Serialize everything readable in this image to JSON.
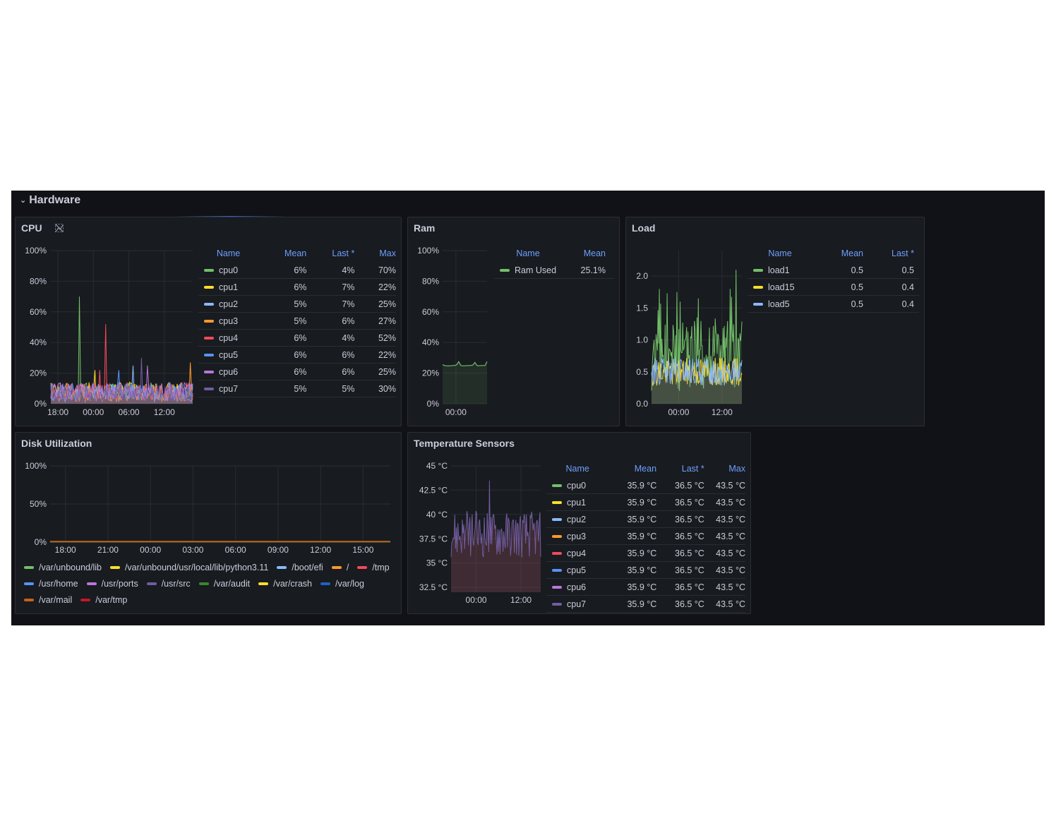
{
  "row": {
    "title": "Hardware"
  },
  "colors": {
    "background": "#111217",
    "panel": "#181b1f",
    "border": "#2c2e33",
    "text": "#ccccdc",
    "header_blue": "#6e9fff",
    "green": "#73bf69",
    "yellow": "#fade2a",
    "light_blue": "#8ab8ff",
    "orange": "#ff9830",
    "red": "#f2495c",
    "blue": "#5794f2",
    "purple": "#b877d9",
    "dark_purple": "#705da0",
    "dark_green": "#37872d",
    "dark_blue": "#1f60c4",
    "dark_orange": "#c4621a",
    "dark_red": "#c4162a"
  },
  "panels": {
    "cpu": {
      "title": "CPU",
      "icon": "no-data-link-icon",
      "columns": [
        "Name",
        "Mean",
        "Last *",
        "Max"
      ],
      "rows": [
        {
          "name": "cpu0",
          "color": "#73bf69",
          "mean": "6%",
          "last": "4%",
          "max": "70%"
        },
        {
          "name": "cpu1",
          "color": "#fade2a",
          "mean": "6%",
          "last": "7%",
          "max": "22%"
        },
        {
          "name": "cpu2",
          "color": "#8ab8ff",
          "mean": "5%",
          "last": "7%",
          "max": "25%"
        },
        {
          "name": "cpu3",
          "color": "#ff9830",
          "mean": "5%",
          "last": "6%",
          "max": "27%"
        },
        {
          "name": "cpu4",
          "color": "#f2495c",
          "mean": "6%",
          "last": "4%",
          "max": "52%"
        },
        {
          "name": "cpu5",
          "color": "#5794f2",
          "mean": "6%",
          "last": "6%",
          "max": "22%"
        },
        {
          "name": "cpu6",
          "color": "#b877d9",
          "mean": "6%",
          "last": "6%",
          "max": "25%"
        },
        {
          "name": "cpu7",
          "color": "#705da0",
          "mean": "5%",
          "last": "5%",
          "max": "30%"
        }
      ]
    },
    "ram": {
      "title": "Ram",
      "columns": [
        "Name",
        "Mean"
      ],
      "rows": [
        {
          "name": "Ram Used",
          "color": "#73bf69",
          "mean": "25.1%"
        }
      ]
    },
    "load": {
      "title": "Load",
      "columns": [
        "Name",
        "Mean",
        "Last *"
      ],
      "rows": [
        {
          "name": "load1",
          "color": "#73bf69",
          "mean": "0.5",
          "last": "0.5"
        },
        {
          "name": "load15",
          "color": "#fade2a",
          "mean": "0.5",
          "last": "0.4"
        },
        {
          "name": "load5",
          "color": "#8ab8ff",
          "mean": "0.5",
          "last": "0.4"
        }
      ]
    },
    "disk": {
      "title": "Disk Utilization",
      "legend": [
        {
          "name": "/var/unbound/lib",
          "color": "#73bf69"
        },
        {
          "name": "/var/unbound/usr/local/lib/python3.11",
          "color": "#fade2a"
        },
        {
          "name": "/boot/efi",
          "color": "#8ab8ff"
        },
        {
          "name": "/",
          "color": "#ff9830"
        },
        {
          "name": "/tmp",
          "color": "#f2495c"
        },
        {
          "name": "/usr/home",
          "color": "#5794f2"
        },
        {
          "name": "/usr/ports",
          "color": "#b877d9"
        },
        {
          "name": "/usr/src",
          "color": "#705da0"
        },
        {
          "name": "/var/audit",
          "color": "#37872d"
        },
        {
          "name": "/var/crash",
          "color": "#fade2a"
        },
        {
          "name": "/var/log",
          "color": "#1f60c4"
        },
        {
          "name": "/var/mail",
          "color": "#c4621a"
        },
        {
          "name": "/var/tmp",
          "color": "#c4162a"
        }
      ]
    },
    "temp": {
      "title": "Temperature Sensors",
      "columns": [
        "Name",
        "Mean",
        "Last *",
        "Max"
      ],
      "rows": [
        {
          "name": "cpu0",
          "color": "#73bf69",
          "mean": "35.9 °C",
          "last": "36.5 °C",
          "max": "43.5 °C"
        },
        {
          "name": "cpu1",
          "color": "#fade2a",
          "mean": "35.9 °C",
          "last": "36.5 °C",
          "max": "43.5 °C"
        },
        {
          "name": "cpu2",
          "color": "#8ab8ff",
          "mean": "35.9 °C",
          "last": "36.5 °C",
          "max": "43.5 °C"
        },
        {
          "name": "cpu3",
          "color": "#ff9830",
          "mean": "35.9 °C",
          "last": "36.5 °C",
          "max": "43.5 °C"
        },
        {
          "name": "cpu4",
          "color": "#f2495c",
          "mean": "35.9 °C",
          "last": "36.5 °C",
          "max": "43.5 °C"
        },
        {
          "name": "cpu5",
          "color": "#5794f2",
          "mean": "35.9 °C",
          "last": "36.5 °C",
          "max": "43.5 °C"
        },
        {
          "name": "cpu6",
          "color": "#b877d9",
          "mean": "35.9 °C",
          "last": "36.5 °C",
          "max": "43.5 °C"
        },
        {
          "name": "cpu7",
          "color": "#705da0",
          "mean": "35.9 °C",
          "last": "36.5 °C",
          "max": "43.5 °C"
        }
      ]
    }
  },
  "chart_data": [
    {
      "id": "cpu",
      "type": "line",
      "title": "CPU",
      "yticks": [
        "0%",
        "20%",
        "40%",
        "60%",
        "80%",
        "100%"
      ],
      "ylim": [
        0,
        100
      ],
      "xticks": [
        "18:00",
        "00:00",
        "06:00",
        "12:00"
      ],
      "xlim": [
        -2,
        22
      ],
      "grid": true,
      "series": [
        {
          "name": "cpu0",
          "color": "#73bf69",
          "baseline": 8,
          "peaks": [
            [
              2.8,
              70
            ]
          ]
        },
        {
          "name": "cpu1",
          "color": "#fade2a",
          "baseline": 8,
          "peaks": [
            [
              5.5,
              22
            ]
          ]
        },
        {
          "name": "cpu2",
          "color": "#8ab8ff",
          "baseline": 7,
          "peaks": [
            [
              12,
              25
            ]
          ]
        },
        {
          "name": "cpu3",
          "color": "#ff9830",
          "baseline": 7,
          "peaks": [
            [
              21.5,
              27
            ]
          ]
        },
        {
          "name": "cpu4",
          "color": "#f2495c",
          "baseline": 8,
          "peaks": [
            [
              7.2,
              52
            ],
            [
              6.3,
              22
            ]
          ]
        },
        {
          "name": "cpu5",
          "color": "#5794f2",
          "baseline": 8,
          "peaks": [
            [
              9.5,
              22
            ]
          ]
        },
        {
          "name": "cpu6",
          "color": "#b877d9",
          "baseline": 8,
          "peaks": [
            [
              14.3,
              25
            ]
          ]
        },
        {
          "name": "cpu7",
          "color": "#705da0",
          "baseline": 7,
          "peaks": [
            [
              13.3,
              30
            ]
          ]
        }
      ]
    },
    {
      "id": "ram",
      "type": "area",
      "title": "Ram",
      "yticks": [
        "0%",
        "20%",
        "40%",
        "60%",
        "80%",
        "100%"
      ],
      "ylim": [
        0,
        100
      ],
      "xticks": [
        "00:00"
      ],
      "grid": true,
      "series": [
        {
          "name": "Ram Used",
          "color": "#73bf69",
          "values": [
            25.5,
            25,
            24.8,
            24.7,
            24.8,
            25,
            25,
            25.5,
            27.5,
            25,
            24.8,
            24.8,
            25,
            25,
            25,
            25.3,
            27,
            25,
            24.8,
            25,
            25,
            25,
            27.5
          ]
        }
      ]
    },
    {
      "id": "load",
      "type": "line",
      "title": "Load",
      "yticks": [
        "0.0",
        "0.5",
        "1.0",
        "1.5",
        "2.0"
      ],
      "ylim": [
        0,
        2.4
      ],
      "xticks": [
        "00:00",
        "12:00"
      ],
      "grid": true,
      "series": [
        {
          "name": "load1",
          "color": "#73bf69",
          "baseline": 0.75,
          "peaks": [
            [
              0.5,
              1.8
            ],
            [
              4.1,
              1.75
            ],
            [
              8.3,
              1.65
            ],
            [
              15.8,
              2.1
            ],
            [
              14.7,
              1.8
            ]
          ]
        },
        {
          "name": "load15",
          "color": "#fade2a",
          "baseline": 0.5,
          "peaks": []
        },
        {
          "name": "load5",
          "color": "#8ab8ff",
          "baseline": 0.5,
          "peaks": []
        }
      ]
    },
    {
      "id": "disk",
      "type": "line",
      "title": "Disk Utilization",
      "yticks": [
        "0%",
        "50%",
        "100%"
      ],
      "ylim": [
        0,
        100
      ],
      "xticks": [
        "18:00",
        "21:00",
        "00:00",
        "03:00",
        "06:00",
        "09:00",
        "12:00",
        "15:00"
      ],
      "grid": true,
      "series": [
        {
          "name": "/var/unbound/lib",
          "color": "#73bf69",
          "values": [
            0.5,
            0.5
          ]
        },
        {
          "name": "/",
          "color": "#ff9830",
          "values": [
            0.8,
            0.8
          ]
        },
        {
          "name": "/var/mail",
          "color": "#c4621a",
          "values": [
            0.6,
            0.6
          ]
        }
      ]
    },
    {
      "id": "temp",
      "type": "area",
      "title": "Temperature Sensors",
      "yticks": [
        "32.5 °C",
        "35 °C",
        "37.5 °C",
        "40 °C",
        "42.5 °C",
        "45 °C"
      ],
      "ylim": [
        32,
        45
      ],
      "xticks": [
        "00:00",
        "12:00"
      ],
      "grid": true,
      "series": [
        {
          "name": "cpu7",
          "color": "#705da0",
          "baseline": 38,
          "peaks": [
            [
              6.8,
              43.5
            ]
          ]
        }
      ]
    }
  ]
}
